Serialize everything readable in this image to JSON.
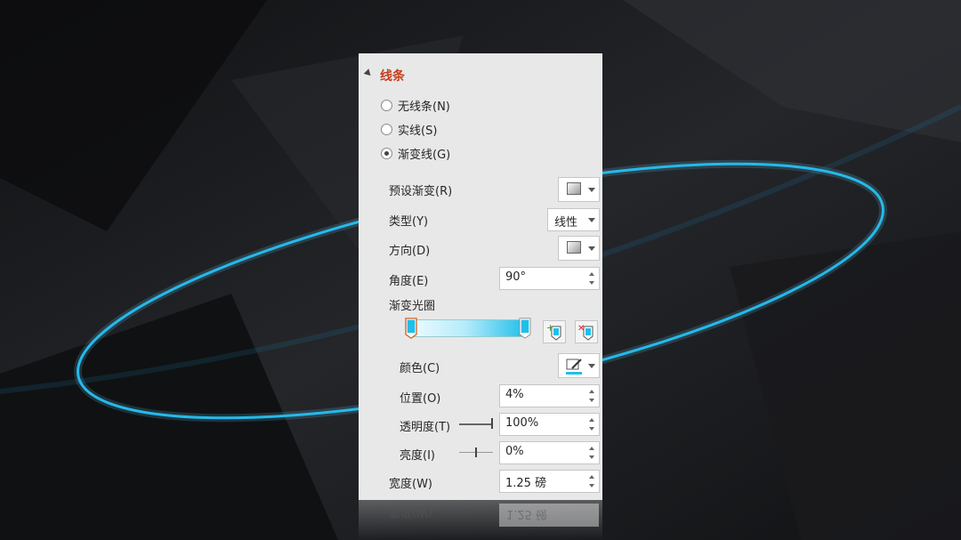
{
  "section": {
    "title": "线条"
  },
  "line_options": [
    {
      "label": "无线条(N)",
      "selected": false
    },
    {
      "label": "实线(S)",
      "selected": false
    },
    {
      "label": "渐变线(G)",
      "selected": true
    }
  ],
  "preset_gradient": {
    "label": "预设渐变(R)"
  },
  "type": {
    "label": "类型(Y)",
    "value": "线性"
  },
  "direction": {
    "label": "方向(D)"
  },
  "angle": {
    "label": "角度(E)",
    "value": "90°"
  },
  "gradient_stops": {
    "label": "渐变光圈"
  },
  "color": {
    "label": "颜色(C)",
    "accent": "#1fbfea"
  },
  "position": {
    "label": "位置(O)",
    "value": "4%"
  },
  "transparency": {
    "label": "透明度(T)",
    "value": "100%",
    "level": 1.0
  },
  "brightness": {
    "label": "亮度(I)",
    "value": "0%",
    "level": 0.5
  },
  "width": {
    "label": "宽度(W)",
    "value": "1.25 磅"
  },
  "reflection": {
    "label": "宽度(W)",
    "value": "1.25 磅"
  },
  "colors": {
    "header": "#c43e1c",
    "panel": "#e8e8e8",
    "ellipse": "#1ab4e6"
  }
}
